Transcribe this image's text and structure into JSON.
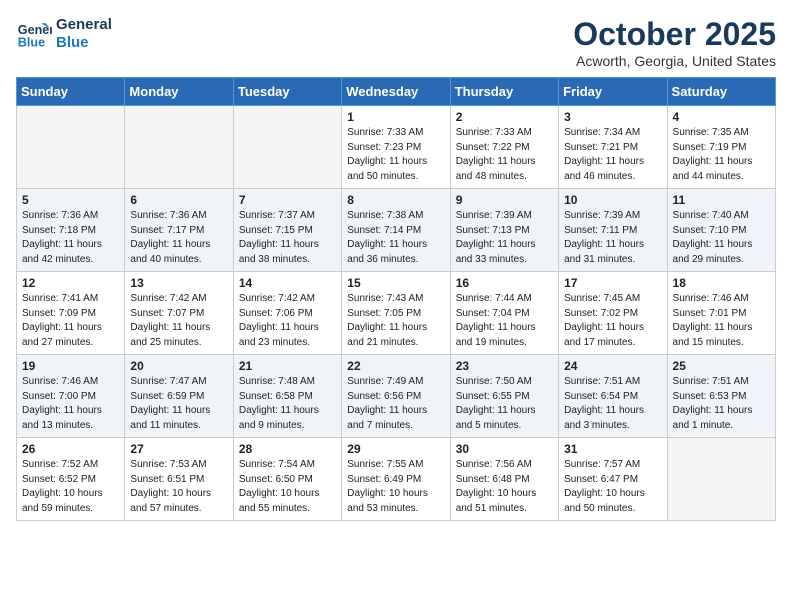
{
  "logo": {
    "line1": "General",
    "line2": "Blue"
  },
  "title": "October 2025",
  "subtitle": "Acworth, Georgia, United States",
  "days_of_week": [
    "Sunday",
    "Monday",
    "Tuesday",
    "Wednesday",
    "Thursday",
    "Friday",
    "Saturday"
  ],
  "weeks": [
    [
      {
        "day": "",
        "info": ""
      },
      {
        "day": "",
        "info": ""
      },
      {
        "day": "",
        "info": ""
      },
      {
        "day": "1",
        "info": "Sunrise: 7:33 AM\nSunset: 7:23 PM\nDaylight: 11 hours\nand 50 minutes."
      },
      {
        "day": "2",
        "info": "Sunrise: 7:33 AM\nSunset: 7:22 PM\nDaylight: 11 hours\nand 48 minutes."
      },
      {
        "day": "3",
        "info": "Sunrise: 7:34 AM\nSunset: 7:21 PM\nDaylight: 11 hours\nand 46 minutes."
      },
      {
        "day": "4",
        "info": "Sunrise: 7:35 AM\nSunset: 7:19 PM\nDaylight: 11 hours\nand 44 minutes."
      }
    ],
    [
      {
        "day": "5",
        "info": "Sunrise: 7:36 AM\nSunset: 7:18 PM\nDaylight: 11 hours\nand 42 minutes."
      },
      {
        "day": "6",
        "info": "Sunrise: 7:36 AM\nSunset: 7:17 PM\nDaylight: 11 hours\nand 40 minutes."
      },
      {
        "day": "7",
        "info": "Sunrise: 7:37 AM\nSunset: 7:15 PM\nDaylight: 11 hours\nand 38 minutes."
      },
      {
        "day": "8",
        "info": "Sunrise: 7:38 AM\nSunset: 7:14 PM\nDaylight: 11 hours\nand 36 minutes."
      },
      {
        "day": "9",
        "info": "Sunrise: 7:39 AM\nSunset: 7:13 PM\nDaylight: 11 hours\nand 33 minutes."
      },
      {
        "day": "10",
        "info": "Sunrise: 7:39 AM\nSunset: 7:11 PM\nDaylight: 11 hours\nand 31 minutes."
      },
      {
        "day": "11",
        "info": "Sunrise: 7:40 AM\nSunset: 7:10 PM\nDaylight: 11 hours\nand 29 minutes."
      }
    ],
    [
      {
        "day": "12",
        "info": "Sunrise: 7:41 AM\nSunset: 7:09 PM\nDaylight: 11 hours\nand 27 minutes."
      },
      {
        "day": "13",
        "info": "Sunrise: 7:42 AM\nSunset: 7:07 PM\nDaylight: 11 hours\nand 25 minutes."
      },
      {
        "day": "14",
        "info": "Sunrise: 7:42 AM\nSunset: 7:06 PM\nDaylight: 11 hours\nand 23 minutes."
      },
      {
        "day": "15",
        "info": "Sunrise: 7:43 AM\nSunset: 7:05 PM\nDaylight: 11 hours\nand 21 minutes."
      },
      {
        "day": "16",
        "info": "Sunrise: 7:44 AM\nSunset: 7:04 PM\nDaylight: 11 hours\nand 19 minutes."
      },
      {
        "day": "17",
        "info": "Sunrise: 7:45 AM\nSunset: 7:02 PM\nDaylight: 11 hours\nand 17 minutes."
      },
      {
        "day": "18",
        "info": "Sunrise: 7:46 AM\nSunset: 7:01 PM\nDaylight: 11 hours\nand 15 minutes."
      }
    ],
    [
      {
        "day": "19",
        "info": "Sunrise: 7:46 AM\nSunset: 7:00 PM\nDaylight: 11 hours\nand 13 minutes."
      },
      {
        "day": "20",
        "info": "Sunrise: 7:47 AM\nSunset: 6:59 PM\nDaylight: 11 hours\nand 11 minutes."
      },
      {
        "day": "21",
        "info": "Sunrise: 7:48 AM\nSunset: 6:58 PM\nDaylight: 11 hours\nand 9 minutes."
      },
      {
        "day": "22",
        "info": "Sunrise: 7:49 AM\nSunset: 6:56 PM\nDaylight: 11 hours\nand 7 minutes."
      },
      {
        "day": "23",
        "info": "Sunrise: 7:50 AM\nSunset: 6:55 PM\nDaylight: 11 hours\nand 5 minutes."
      },
      {
        "day": "24",
        "info": "Sunrise: 7:51 AM\nSunset: 6:54 PM\nDaylight: 11 hours\nand 3 minutes."
      },
      {
        "day": "25",
        "info": "Sunrise: 7:51 AM\nSunset: 6:53 PM\nDaylight: 11 hours\nand 1 minute."
      }
    ],
    [
      {
        "day": "26",
        "info": "Sunrise: 7:52 AM\nSunset: 6:52 PM\nDaylight: 10 hours\nand 59 minutes."
      },
      {
        "day": "27",
        "info": "Sunrise: 7:53 AM\nSunset: 6:51 PM\nDaylight: 10 hours\nand 57 minutes."
      },
      {
        "day": "28",
        "info": "Sunrise: 7:54 AM\nSunset: 6:50 PM\nDaylight: 10 hours\nand 55 minutes."
      },
      {
        "day": "29",
        "info": "Sunrise: 7:55 AM\nSunset: 6:49 PM\nDaylight: 10 hours\nand 53 minutes."
      },
      {
        "day": "30",
        "info": "Sunrise: 7:56 AM\nSunset: 6:48 PM\nDaylight: 10 hours\nand 51 minutes."
      },
      {
        "day": "31",
        "info": "Sunrise: 7:57 AM\nSunset: 6:47 PM\nDaylight: 10 hours\nand 50 minutes."
      },
      {
        "day": "",
        "info": ""
      }
    ]
  ]
}
